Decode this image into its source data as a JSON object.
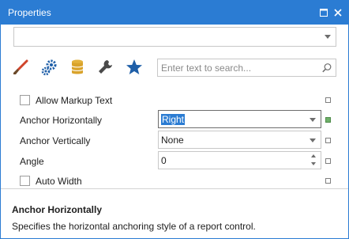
{
  "window": {
    "title": "Properties",
    "accent_color": "#2b7cd3",
    "restore_icon": "restore-icon",
    "close_icon": "close-icon"
  },
  "object_selector": {
    "value": "",
    "icon": "chevron-down-icon"
  },
  "tabs": [
    {
      "name": "appearance",
      "icon": "brush-icon"
    },
    {
      "name": "behavior",
      "icon": "gears-icon"
    },
    {
      "name": "data",
      "icon": "database-icon"
    },
    {
      "name": "design",
      "icon": "wrench-icon"
    },
    {
      "name": "favorites",
      "icon": "star-icon"
    }
  ],
  "search": {
    "placeholder": "Enter text to search...",
    "icon": "search-icon"
  },
  "properties": [
    {
      "label": "Allow Markup Text",
      "type": "checkbox",
      "checked": false
    },
    {
      "label": "Anchor Horizontally",
      "type": "dropdown",
      "value": "Right",
      "selected": true,
      "modified": true
    },
    {
      "label": "Anchor Vertically",
      "type": "dropdown",
      "value": "None"
    },
    {
      "label": "Angle",
      "type": "spin",
      "value": "0"
    },
    {
      "label": "Auto Width",
      "type": "checkbox",
      "checked": false
    }
  ],
  "description": {
    "title": "Anchor Horizontally",
    "text": "Specifies the horizontal anchoring style of a report control."
  },
  "colors": {
    "modified_marker": "#6fb16a",
    "selection": "#2b7cd3"
  }
}
